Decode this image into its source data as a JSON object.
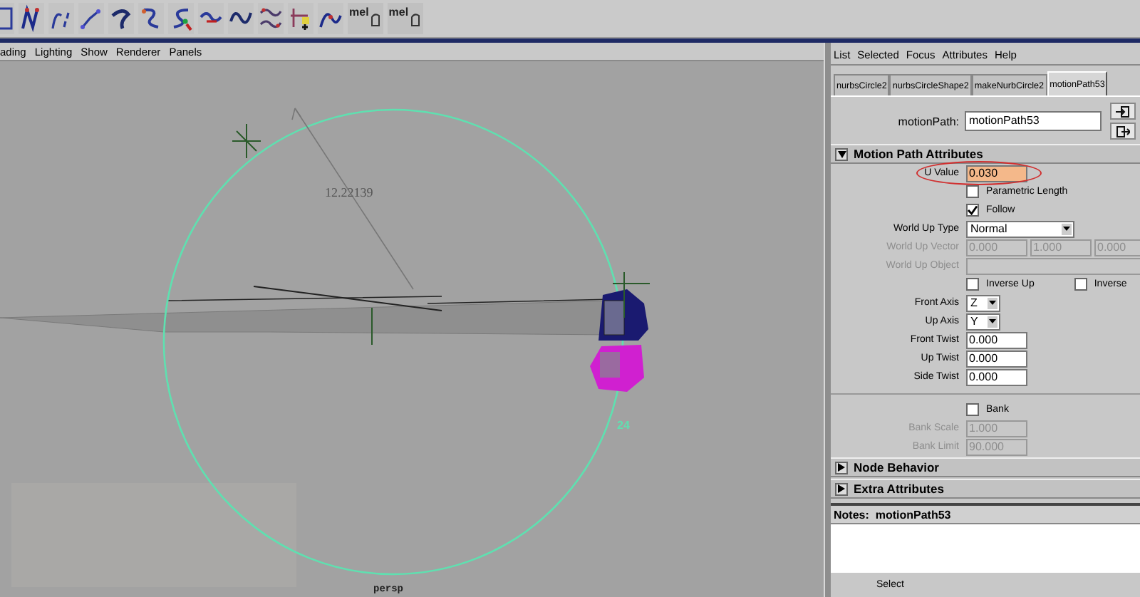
{
  "shelf": {
    "mel_buttons": [
      {
        "label": "mel"
      },
      {
        "label": "mel"
      }
    ]
  },
  "viewport": {
    "menu": [
      "ading",
      "Lighting",
      "Show",
      "Renderer",
      "Panels"
    ],
    "distance_label": "12.22139",
    "frame_label": "24",
    "camera_label": "persp"
  },
  "attribute_editor": {
    "menu": [
      "List",
      "Selected",
      "Focus",
      "Attributes",
      "Help"
    ],
    "tabs": [
      {
        "label": "nurbsCircle2",
        "selected": false
      },
      {
        "label": "nurbsCircleShape2",
        "selected": false
      },
      {
        "label": "makeNurbCircle2",
        "selected": false
      },
      {
        "label": "motionPath53",
        "selected": true
      }
    ],
    "node_field": {
      "label": "motionPath:",
      "value": "motionPath53"
    },
    "sections": [
      {
        "title": "Motion Path Attributes",
        "expanded": true,
        "rows": [
          {
            "kind": "field",
            "label": "U Value",
            "value": "0.030",
            "disabled": false,
            "highlighted": true,
            "circled": true
          },
          {
            "kind": "checkbox",
            "label": "Parametric Length",
            "checked": false
          },
          {
            "kind": "checkbox",
            "label": "Follow",
            "checked": true
          },
          {
            "kind": "dropdown",
            "label": "World Up Type",
            "value": "Normal",
            "wide": true
          },
          {
            "kind": "vector",
            "label": "World Up Vector",
            "values": [
              "0.000",
              "1.000",
              "0.000"
            ],
            "disabled": true
          },
          {
            "kind": "field",
            "label": "World Up Object",
            "disabled": true,
            "wide": true
          },
          {
            "kind": "checkbox_pair",
            "items": [
              {
                "label": "Inverse Up",
                "checked": false
              },
              {
                "label": "Inverse",
                "checked": false
              }
            ]
          },
          {
            "kind": "dropdown",
            "label": "Front Axis",
            "value": "Z",
            "wide": false
          },
          {
            "kind": "dropdown",
            "label": "Up Axis",
            "value": "Y",
            "wide": false
          },
          {
            "kind": "field",
            "label": "Front Twist",
            "value": "0.000",
            "disabled": false
          },
          {
            "kind": "field",
            "label": "Up Twist",
            "value": "0.000",
            "disabled": false
          },
          {
            "kind": "field",
            "label": "Side Twist",
            "value": "0.000",
            "disabled": false
          },
          {
            "kind": "separator"
          },
          {
            "kind": "checkbox",
            "label": "Bank",
            "checked": false
          },
          {
            "kind": "field",
            "label": "Bank Scale",
            "value": "1.000",
            "disabled": true
          },
          {
            "kind": "field",
            "label": "Bank Limit",
            "value": "90.000",
            "disabled": true
          }
        ]
      },
      {
        "title": "Node Behavior",
        "expanded": false
      },
      {
        "title": "Extra Attributes",
        "expanded": false
      }
    ],
    "notes": {
      "title": "Notes:  motionPath53"
    },
    "buttons": [
      "Select"
    ]
  }
}
